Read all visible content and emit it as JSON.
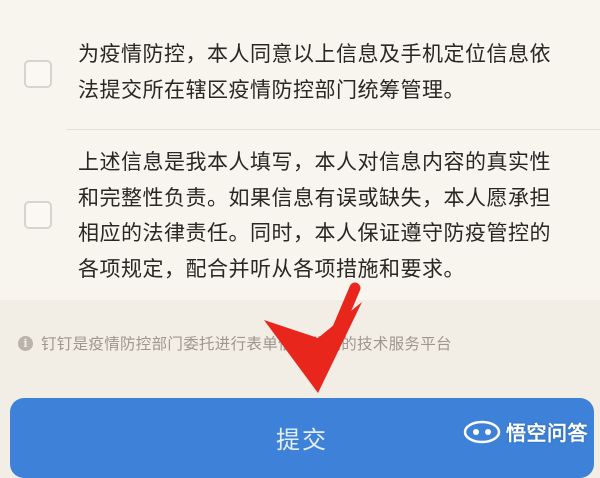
{
  "form": {
    "consents": [
      {
        "lines": [
          "为疫情防控，本人同意以上信息及手机定位信息依",
          "法提交所在辖区疫情防控部门统筹管理。"
        ]
      },
      {
        "lines": [
          "上述信息是我本人填写，本人对信息内容的真实性",
          "和完整性负责。如果信息有误或缺失，本人愿承担",
          "相应的法律责任。同时，本人保证遵守防疫管控的",
          "各项规定，配合并听从各项措施和要求。"
        ]
      }
    ],
    "notice": {
      "icon": "info-icon",
      "text": "钉钉是疫情防控部门委托进行表单信息收集的技术服务平台"
    },
    "submit_label": "提交"
  },
  "watermark": {
    "text": "悟空问答"
  },
  "colors": {
    "background": "#f2ede5",
    "submit_button": "#3d82d8",
    "arrow": "#e8261c"
  }
}
